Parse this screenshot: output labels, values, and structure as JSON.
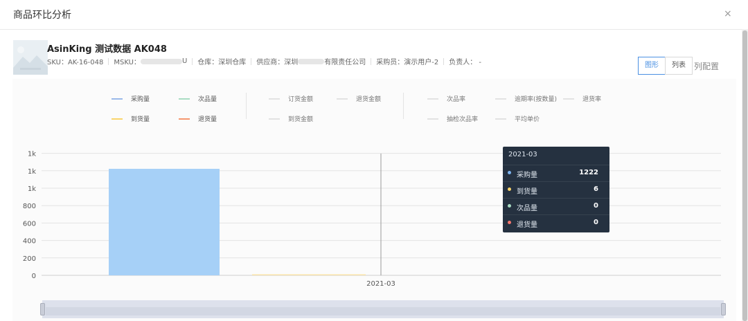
{
  "dialog": {
    "title": "商品环比分析",
    "close_label": "×"
  },
  "product": {
    "name": "AsinKing 测试数据 AK048",
    "sku": "SKU：AK-16-048",
    "msku_label": "MSKU：",
    "msku_tail": "U",
    "warehouse": "仓库：深圳仓库",
    "supplier_prefix": "供应商：深圳",
    "supplier_suffix": "有限责任公司",
    "buyer": "采购员：演示用户-2",
    "owner": "负责人： -"
  },
  "view": {
    "graph_label": "图形",
    "list_label": "列表",
    "colcfg_label": "列配置",
    "active": "graph"
  },
  "legend": [
    {
      "label": "采购量",
      "color": "#9ab9ea",
      "active": true
    },
    {
      "label": "次品量",
      "color": "#a8dcc3",
      "active": true
    },
    {
      "label": "到货量",
      "color": "#f9d46a",
      "active": true
    },
    {
      "label": "退货量",
      "color": "#f5966e",
      "active": true
    },
    {
      "label": "订货金额",
      "color": "#e2e2e2",
      "active": false
    },
    {
      "label": "退货金额",
      "color": "#e2e2e2",
      "active": false
    },
    {
      "label": "到货金额",
      "color": "#e2e2e2",
      "active": false
    },
    {
      "label": "次品率",
      "color": "#e2e2e2",
      "active": false
    },
    {
      "label": "逾期率(按数量)",
      "color": "#e2e2e2",
      "active": false
    },
    {
      "label": "退货率",
      "color": "#e2e2e2",
      "active": false
    },
    {
      "label": "抽检次品率",
      "color": "#e2e2e2",
      "active": false
    },
    {
      "label": "平均单价",
      "color": "#e2e2e2",
      "active": false
    }
  ],
  "tooltip": {
    "date": "2021-03",
    "rows": [
      {
        "label": "采购量",
        "value": "1222",
        "color": "#7db4f0"
      },
      {
        "label": "到货量",
        "value": "6",
        "color": "#f9d46a"
      },
      {
        "label": "次品量",
        "value": "0",
        "color": "#a8dcc3"
      },
      {
        "label": "退货量",
        "value": "0",
        "color": "#f5766e"
      }
    ]
  },
  "chart_data": {
    "type": "bar",
    "categories": [
      "2021-03"
    ],
    "series": [
      {
        "name": "采购量",
        "values": [
          1222
        ],
        "color": "#a6d0f7"
      },
      {
        "name": "到货量",
        "values": [
          6
        ],
        "color": "#f9e3a8"
      },
      {
        "name": "次品量",
        "values": [
          0
        ],
        "color": "#a8dcc3"
      },
      {
        "name": "退货量",
        "values": [
          0
        ],
        "color": "#f5966e"
      }
    ],
    "y_tick_labels": [
      "0",
      "200",
      "400",
      "600",
      "800",
      "1k",
      "1k",
      "1k"
    ],
    "y_tick_values": [
      0,
      200,
      400,
      600,
      800,
      1000,
      1200,
      1400
    ],
    "ylim": [
      0,
      1400
    ],
    "grid": true
  }
}
